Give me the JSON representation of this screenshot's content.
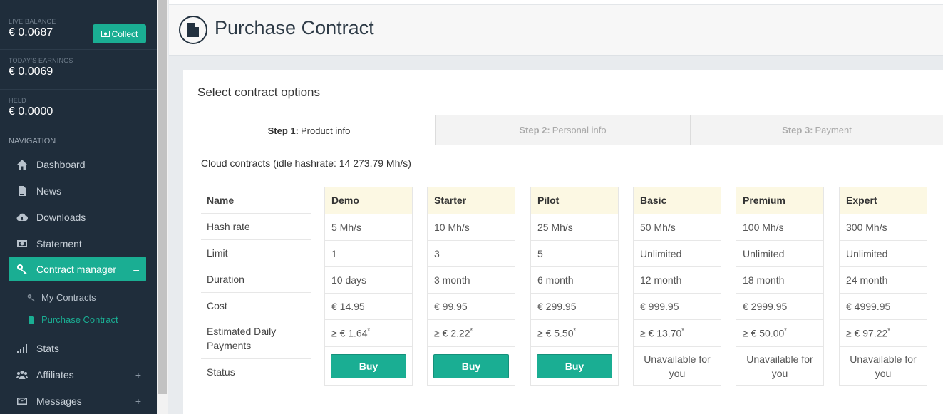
{
  "sidebar": {
    "live_balance_label": "LIVE BALANCE",
    "live_balance_value": "€ 0.0687",
    "collect_label": "Collect",
    "todays_earnings_label": "TODAY'S EARNINGS",
    "todays_earnings_value": "€ 0.0069",
    "held_label": "HELD",
    "held_value": "€ 0.0000",
    "nav_heading": "NAVIGATION",
    "items": [
      {
        "label": "Dashboard",
        "icon": "home-icon"
      },
      {
        "label": "News",
        "icon": "document-icon"
      },
      {
        "label": "Downloads",
        "icon": "cloud-download-icon"
      },
      {
        "label": "Statement",
        "icon": "money-icon"
      },
      {
        "label": "Contract manager",
        "icon": "key-icon",
        "active": true,
        "toggle": "–"
      },
      {
        "label": "Stats",
        "icon": "bar-chart-icon"
      },
      {
        "label": "Affiliates",
        "icon": "users-icon",
        "toggle": "+"
      },
      {
        "label": "Messages",
        "icon": "envelope-icon",
        "toggle": "+"
      }
    ],
    "subitems": [
      {
        "label": "My Contracts",
        "icon": "key-icon"
      },
      {
        "label": "Purchase Contract",
        "icon": "file-icon",
        "current": true
      }
    ]
  },
  "header": {
    "title": "Purchase Contract"
  },
  "panel": {
    "heading": "Select contract options",
    "steps": [
      {
        "prefix": "Step 1:",
        "label": "Product info"
      },
      {
        "prefix": "Step 2:",
        "label": "Personal info"
      },
      {
        "prefix": "Step 3:",
        "label": "Payment"
      }
    ],
    "cloud_heading": "Cloud contracts (idle hashrate: 14 273.79 Mh/s)",
    "row_labels": [
      "Name",
      "Hash rate",
      "Limit",
      "Duration",
      "Cost",
      "Estimated Daily Payments",
      "Status"
    ],
    "plans": [
      {
        "name": "Demo",
        "hash_rate": "5 Mh/s",
        "limit": "1",
        "duration": "10 days",
        "cost": "€ 14.95",
        "est": "≥ € 1.64",
        "action": "Buy"
      },
      {
        "name": "Starter",
        "hash_rate": "10 Mh/s",
        "limit": "3",
        "duration": "3 month",
        "cost": "€ 99.95",
        "est": "≥ € 2.22",
        "action": "Buy"
      },
      {
        "name": "Pilot",
        "hash_rate": "25 Mh/s",
        "limit": "5",
        "duration": "6 month",
        "cost": "€ 299.95",
        "est": "≥ € 5.50",
        "action": "Buy"
      },
      {
        "name": "Basic",
        "hash_rate": "50 Mh/s",
        "limit": "Unlimited",
        "duration": "12 month",
        "cost": "€ 999.95",
        "est": "≥ € 13.70",
        "action": "Unavailable for you"
      },
      {
        "name": "Premium",
        "hash_rate": "100 Mh/s",
        "limit": "Unlimited",
        "duration": "18 month",
        "cost": "€ 2999.95",
        "est": "≥ € 50.00",
        "action": "Unavailable for you"
      },
      {
        "name": "Expert",
        "hash_rate": "300 Mh/s",
        "limit": "Unlimited",
        "duration": "24 month",
        "cost": "€ 4999.95",
        "est": "≥ € 97.22",
        "action": "Unavailable for you"
      }
    ],
    "asterisk": "*"
  },
  "colors": {
    "sidebar_bg": "#1f2d3b",
    "accent": "#1aae93",
    "plan_header_bg": "#fcf8e3"
  }
}
